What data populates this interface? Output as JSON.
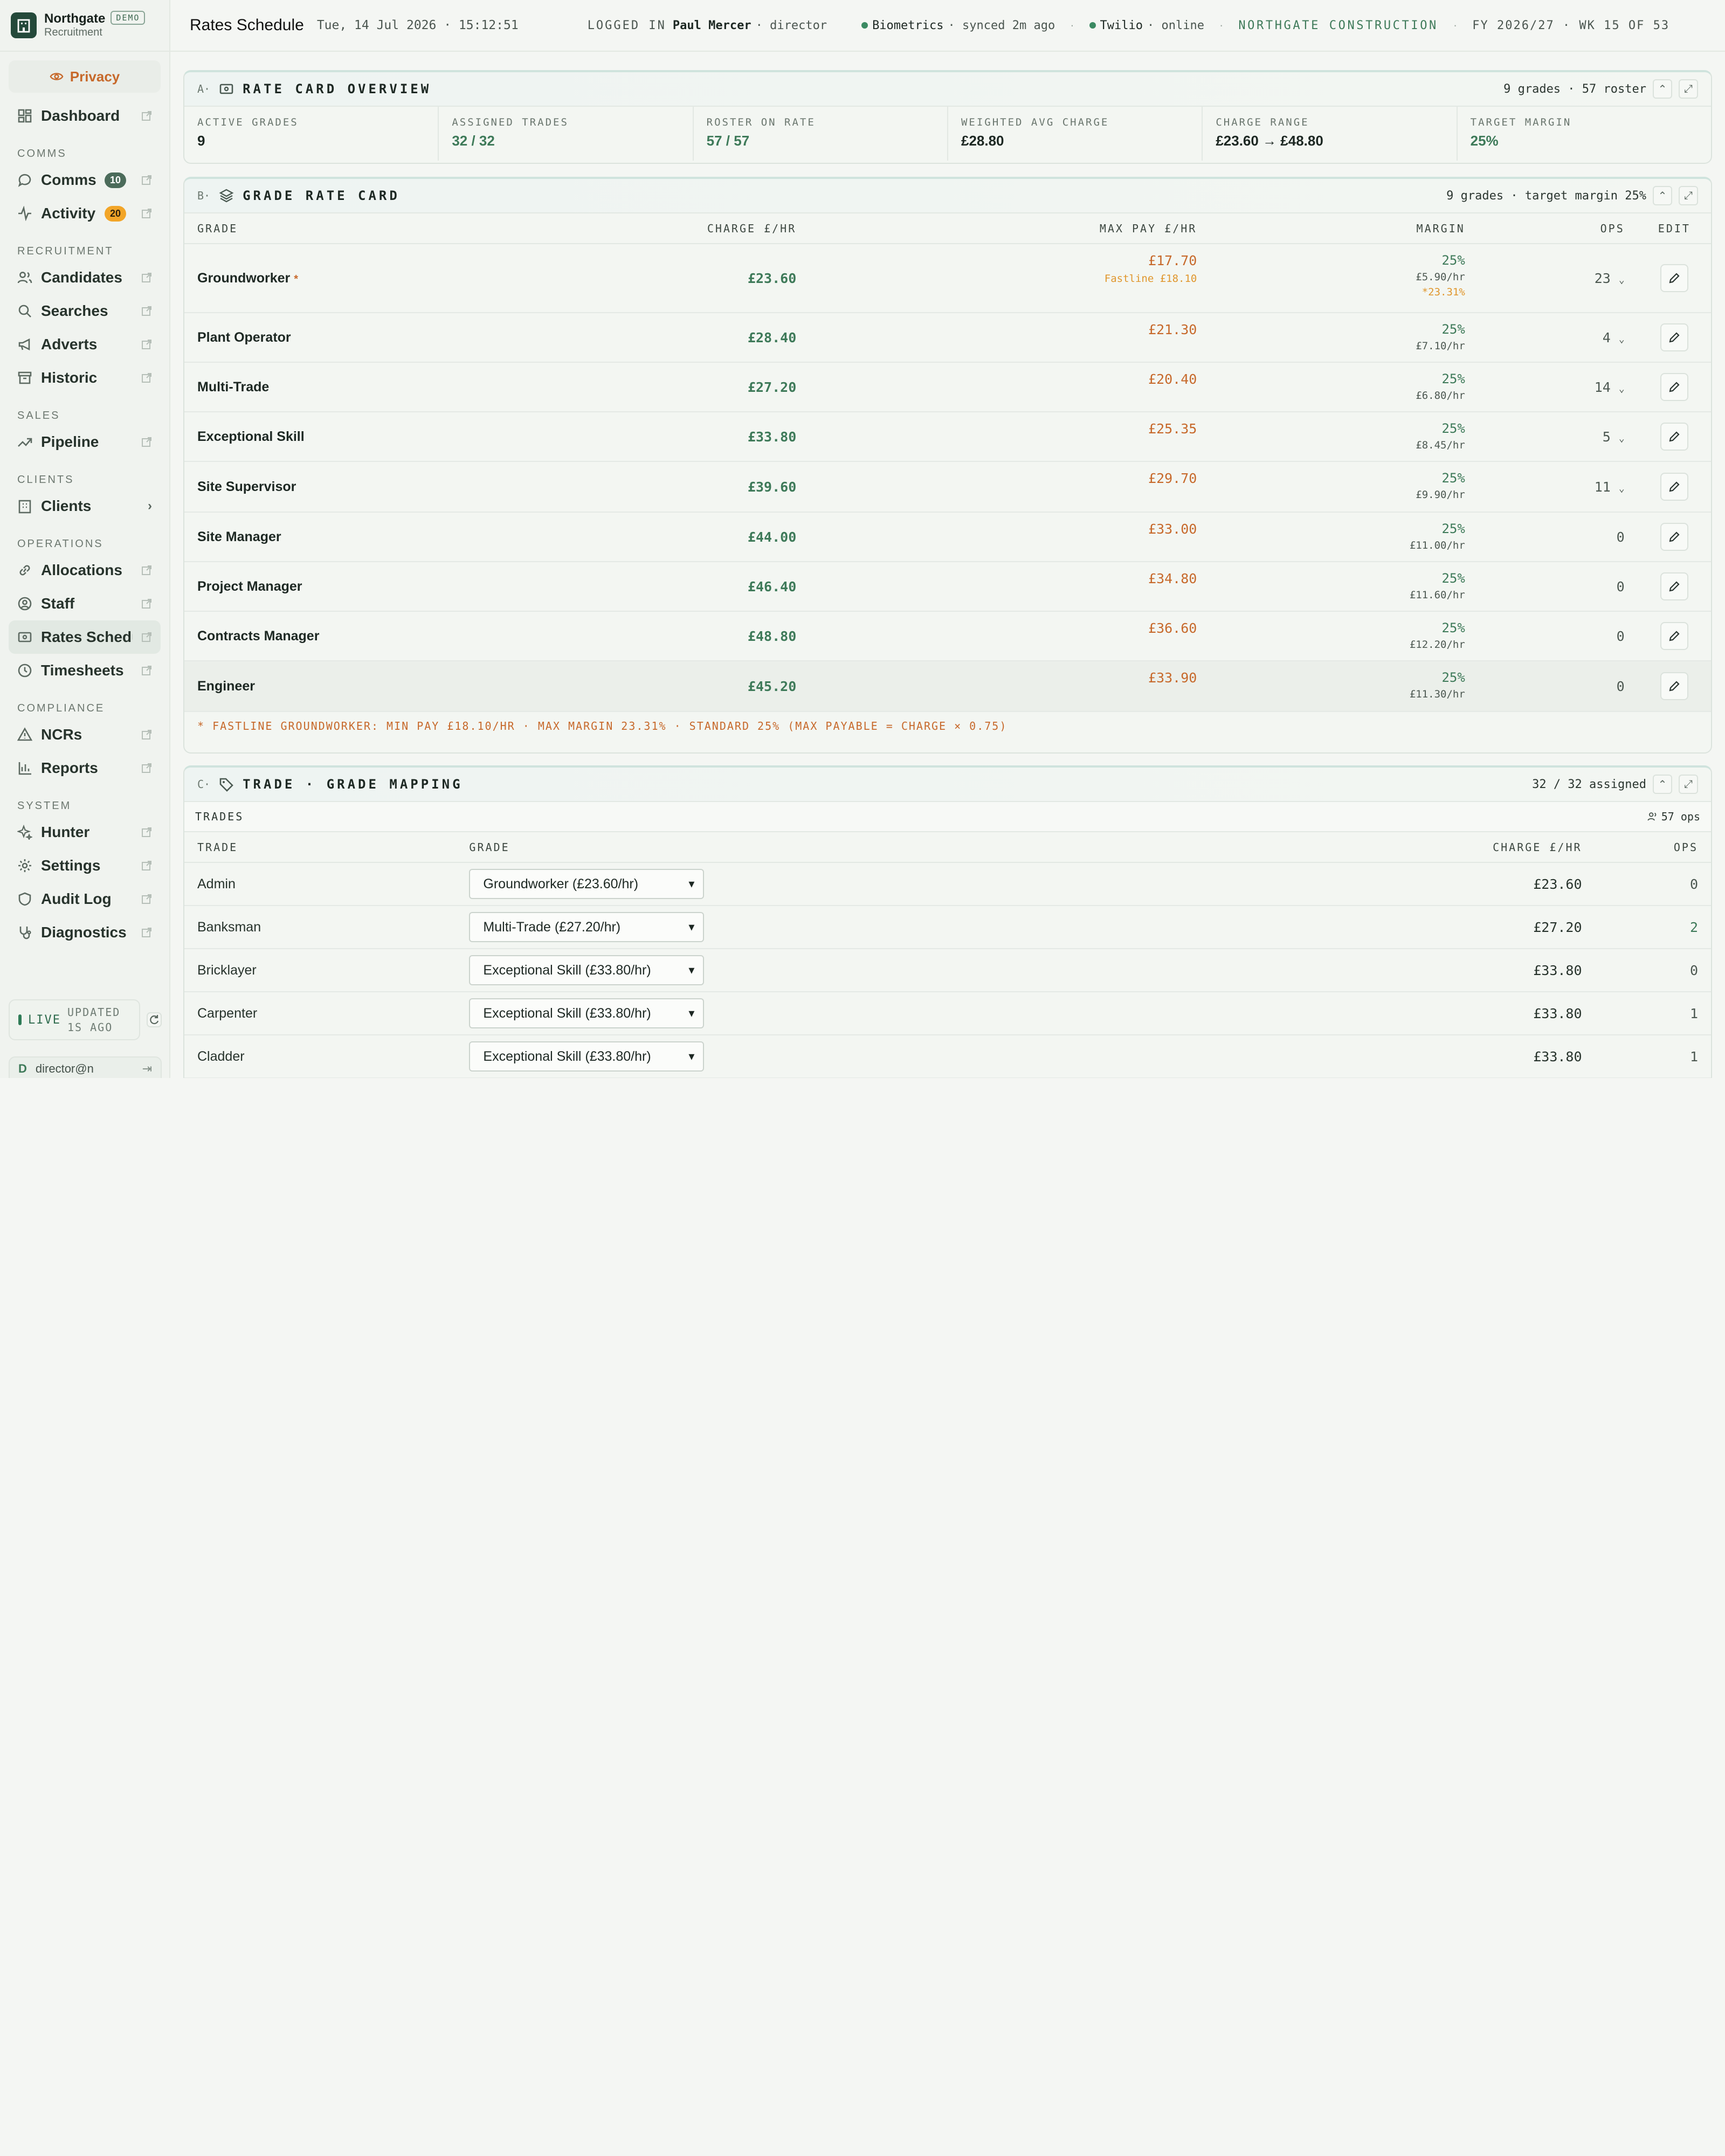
{
  "brand": {
    "name": "Northgate",
    "sub": "Recruitment",
    "badge": "DEMO"
  },
  "privacy_label": "Privacy",
  "nav": {
    "dashboard": "Dashboard",
    "sec_comms": "COMMS",
    "comms": "Comms",
    "comms_badge": "10",
    "activity": "Activity",
    "activity_badge": "20",
    "sec_recruitment": "RECRUITMENT",
    "candidates": "Candidates",
    "searches": "Searches",
    "adverts": "Adverts",
    "historic": "Historic",
    "sec_sales": "SALES",
    "pipeline": "Pipeline",
    "sec_clients": "CLIENTS",
    "clients": "Clients",
    "sec_operations": "OPERATIONS",
    "allocations": "Allocations",
    "staff": "Staff",
    "rates": "Rates Schedule",
    "timesheets": "Timesheets",
    "sec_compliance": "COMPLIANCE",
    "ncrs": "NCRs",
    "reports": "Reports",
    "sec_system": "SYSTEM",
    "hunter": "Hunter",
    "settings": "Settings",
    "audit": "Audit Log",
    "diagnostics": "Diagnostics"
  },
  "live": {
    "label": "LIVE",
    "updated1": "UPDATED",
    "updated2": "1S AGO"
  },
  "user": {
    "initial": "D",
    "email": "director@n"
  },
  "top": {
    "title": "Rates Schedule",
    "datetime": "Tue, 14 Jul 2026 · 15:12:51",
    "logged_prefix": "LOGGED IN",
    "user": "Paul Mercer",
    "role": "· director",
    "bio": "Biometrics",
    "bio_status": "· synced 2m ago",
    "twilio": "Twilio",
    "twilio_status": "· online",
    "company": "NORTHGATE CONSTRUCTION",
    "fy": "FY 2026/27 · WK 15 OF 53"
  },
  "card_a": {
    "letter": "A·",
    "title": "RATE CARD OVERVIEW",
    "meta": "9 grades · 57 roster",
    "kpis": [
      {
        "label": "ACTIVE GRADES",
        "value": "9"
      },
      {
        "label": "ASSIGNED TRADES",
        "value": "32 / 32"
      },
      {
        "label": "ROSTER ON RATE",
        "value": "57 / 57"
      },
      {
        "label": "WEIGHTED AVG CHARGE",
        "value": "£28.80"
      },
      {
        "label": "CHARGE RANGE",
        "value": "£23.60 → £48.80"
      },
      {
        "label": "TARGET MARGIN",
        "value": "25%"
      }
    ]
  },
  "card_b": {
    "letter": "B·",
    "title": "GRADE RATE CARD",
    "meta": "9 grades · target margin 25%",
    "headers": {
      "grade": "GRADE",
      "charge": "CHARGE £/HR",
      "maxpay": "MAX PAY £/HR",
      "margin": "MARGIN",
      "ops": "OPS",
      "edit": "EDIT"
    },
    "rows": [
      {
        "grade": "Groundworker",
        "star": "*",
        "charge": "£23.60",
        "maxpay": "£17.70",
        "fastline": "Fastline £18.10",
        "margin": "25%",
        "perhr": "£5.90/hr",
        "note": "*23.31%",
        "ops": "23"
      },
      {
        "grade": "Plant Operator",
        "charge": "£28.40",
        "maxpay": "£21.30",
        "margin": "25%",
        "perhr": "£7.10/hr",
        "ops": "4"
      },
      {
        "grade": "Multi-Trade",
        "charge": "£27.20",
        "maxpay": "£20.40",
        "margin": "25%",
        "perhr": "£6.80/hr",
        "ops": "14"
      },
      {
        "grade": "Exceptional Skill",
        "charge": "£33.80",
        "maxpay": "£25.35",
        "margin": "25%",
        "perhr": "£8.45/hr",
        "ops": "5"
      },
      {
        "grade": "Site Supervisor",
        "charge": "£39.60",
        "maxpay": "£29.70",
        "margin": "25%",
        "perhr": "£9.90/hr",
        "ops": "11"
      },
      {
        "grade": "Site Manager",
        "charge": "£44.00",
        "maxpay": "£33.00",
        "margin": "25%",
        "perhr": "£11.00/hr",
        "ops": "0"
      },
      {
        "grade": "Project Manager",
        "charge": "£46.40",
        "maxpay": "£34.80",
        "margin": "25%",
        "perhr": "£11.60/hr",
        "ops": "0"
      },
      {
        "grade": "Contracts Manager",
        "charge": "£48.80",
        "maxpay": "£36.60",
        "margin": "25%",
        "perhr": "£12.20/hr",
        "ops": "0"
      },
      {
        "grade": "Engineer",
        "charge": "£45.20",
        "maxpay": "£33.90",
        "margin": "25%",
        "perhr": "£11.30/hr",
        "ops": "0"
      }
    ],
    "footnote": "* FASTLINE GROUNDWORKER: MIN PAY £18.10/HR · MAX MARGIN 23.31% · STANDARD 25% (MAX PAYABLE = CHARGE × 0.75)"
  },
  "card_c": {
    "letter": "C·",
    "title": "TRADE · GRADE MAPPING",
    "meta": "32 / 32 assigned",
    "sub_label": "TRADES",
    "sub_ops": "57 ops",
    "headers": {
      "trade": "TRADE",
      "grade": "GRADE",
      "charge": "CHARGE £/HR",
      "ops": "OPS"
    },
    "rows": [
      {
        "trade": "Admin",
        "grade": "Groundworker (£23.60/hr)",
        "charge": "£23.60",
        "ops": "0"
      },
      {
        "trade": "Banksman",
        "grade": "Multi-Trade (£27.20/hr)",
        "charge": "£27.20",
        "ops": "2"
      },
      {
        "trade": "Bricklayer",
        "grade": "Exceptional Skill (£33.80/hr)",
        "charge": "£33.80",
        "ops": "0"
      },
      {
        "trade": "Carpenter",
        "grade": "Exceptional Skill (£33.80/hr)",
        "charge": "£33.80",
        "ops": "1"
      },
      {
        "trade": "Cladder",
        "grade": "Exceptional Skill (£33.80/hr)",
        "charge": "£33.80",
        "ops": "1"
      }
    ]
  },
  "colors": {
    "accent": "#3e7a59",
    "orange": "#c7692b",
    "brand": "#24493a"
  }
}
